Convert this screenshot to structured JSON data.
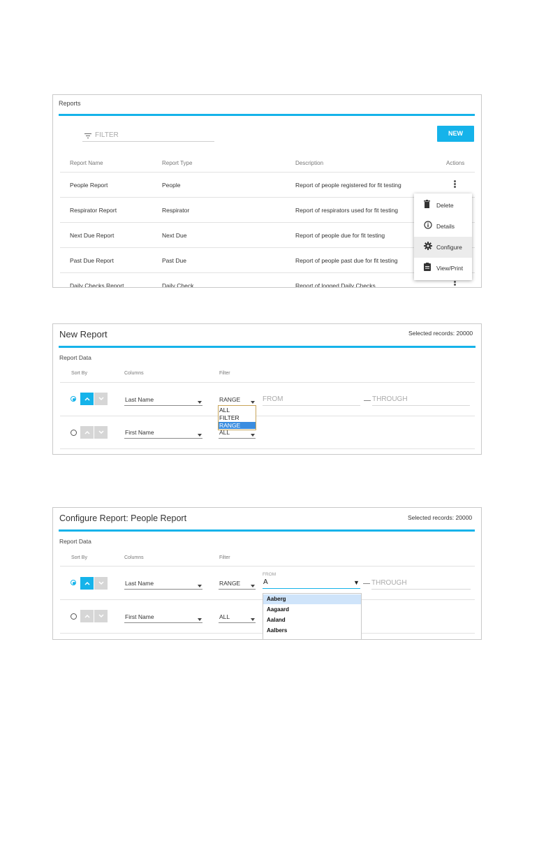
{
  "panel1": {
    "title": "Reports",
    "filter_placeholder": "FILTER",
    "new_label": "NEW",
    "columns": [
      "Report Name",
      "Report Type",
      "Description",
      "Actions"
    ],
    "rows": [
      {
        "name": "People Report",
        "type": "People",
        "description": "Report of people registered for fit testing"
      },
      {
        "name": "Respirator Report",
        "type": "Respirator",
        "description": "Report of respirators used for fit testing"
      },
      {
        "name": "Next Due Report",
        "type": "Next Due",
        "description": "Report of people due for fit testing"
      },
      {
        "name": "Past Due Report",
        "type": "Past Due",
        "description": "Report of people past due for fit testing"
      },
      {
        "name": "Daily Checks Report",
        "type": "Daily Check",
        "description": "Report of logged Daily Checks"
      }
    ],
    "menu": {
      "items": [
        {
          "label": "Delete",
          "icon": "trash-icon"
        },
        {
          "label": "Details",
          "icon": "info-icon"
        },
        {
          "label": "Configure",
          "icon": "gear-icon"
        },
        {
          "label": "View/Print",
          "icon": "clipboard-icon"
        }
      ]
    }
  },
  "panel2": {
    "title": "New Report",
    "selected": "Selected records: 20000",
    "section": "Report Data",
    "headers": {
      "sort": "Sort By",
      "columns": "Columns",
      "filter": "Filter"
    },
    "row1": {
      "column": "Last Name",
      "filter": "RANGE",
      "from": "FROM",
      "through": "THROUGH"
    },
    "row2": {
      "column": "First Name",
      "filter": "ALL"
    },
    "filter_options": [
      "ALL",
      "FILTER",
      "RANGE"
    ],
    "selected_option": "RANGE"
  },
  "panel3": {
    "title": "Configure Report: People Report",
    "selected": "Selected records: 20000",
    "section": "Report Data",
    "headers": {
      "sort": "Sort By",
      "columns": "Columns",
      "filter": "Filter"
    },
    "row1": {
      "column": "Last Name",
      "filter": "RANGE",
      "from_label": "FROM",
      "from_value": "A",
      "through": "THROUGH"
    },
    "row2": {
      "column": "First Name",
      "filter": "ALL"
    },
    "from_options": [
      "Aaberg",
      "Aagaard",
      "Aaland",
      "Aalbers"
    ]
  },
  "colors": {
    "accent": "#15b3ea",
    "highlight": "#3a8de0",
    "option_hover": "#cfe4fa"
  }
}
